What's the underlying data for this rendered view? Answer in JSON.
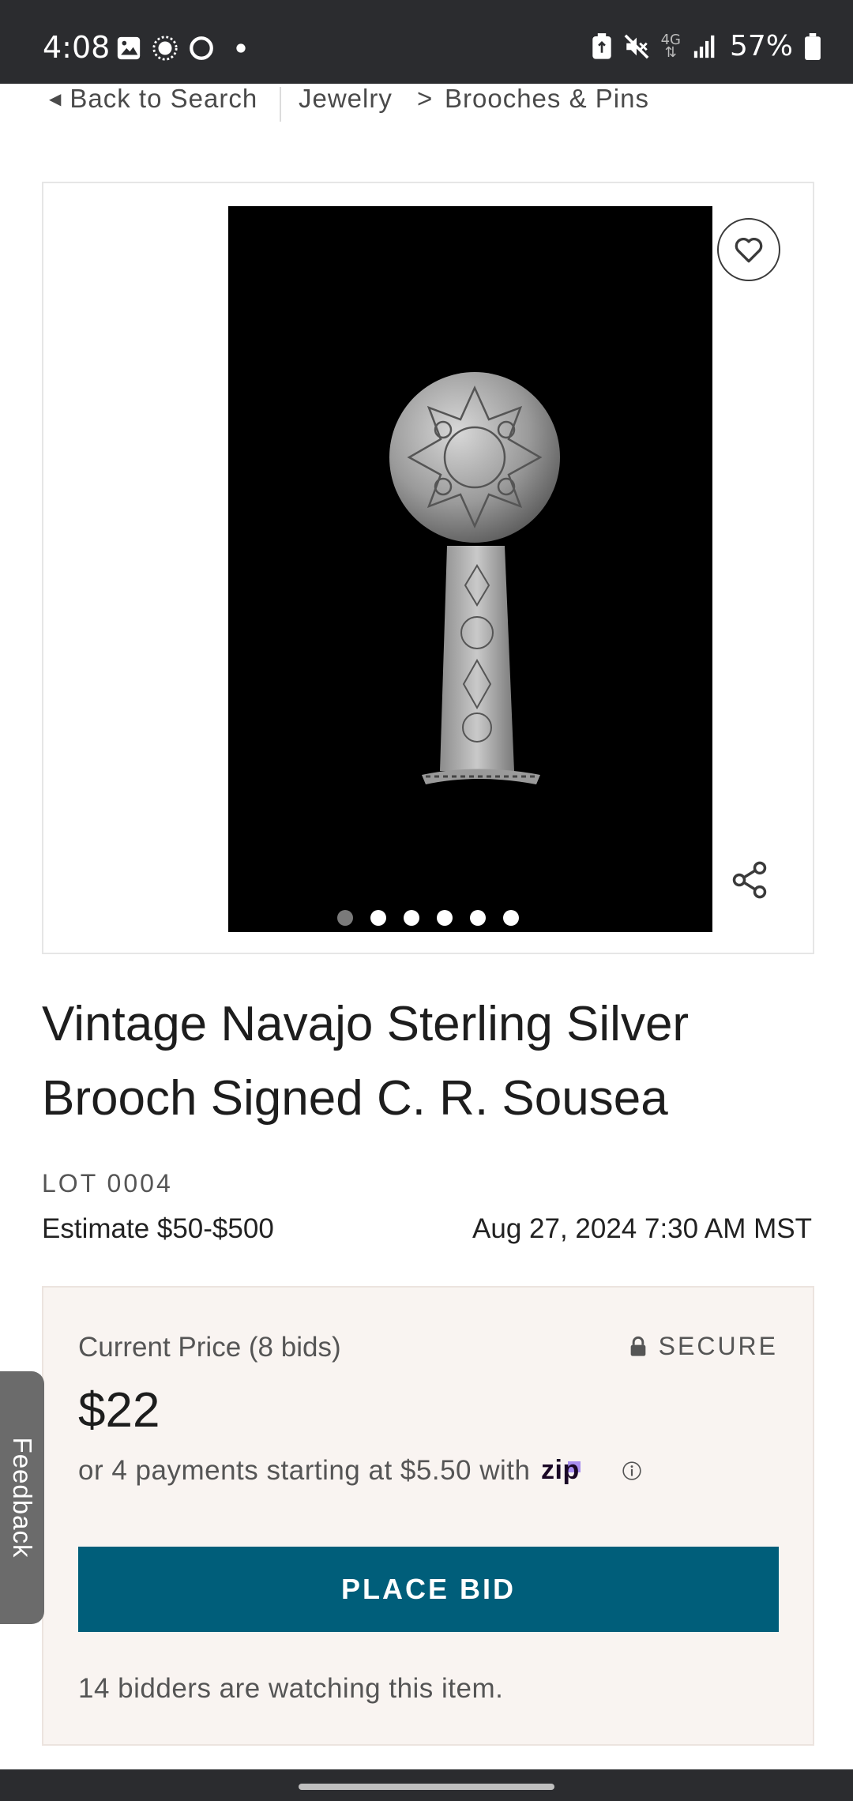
{
  "status_bar": {
    "time": "4:08",
    "battery": "57%",
    "network": "4G",
    "icons_left": [
      "gallery-icon",
      "record-icon",
      "circle-icon",
      "dot-icon"
    ],
    "icons_right": [
      "battery-saver-icon",
      "mute-icon",
      "4g-icon",
      "signal-icon",
      "battery-icon"
    ]
  },
  "breadcrumb": {
    "back_label": "Back to Search",
    "category": "Jewelry",
    "separator": ">",
    "subcategory": "Brooches & Pins"
  },
  "gallery": {
    "image_count": 6,
    "active_index": 0,
    "favorite_icon": "heart-icon",
    "share_icon": "share-icon"
  },
  "item": {
    "title": "Vintage Navajo Sterling Silver Brooch Signed C. R. Sousea",
    "lot": "LOT 0004",
    "estimate": "Estimate $50-$500",
    "date": "Aug 27, 2024 7:30 AM MST"
  },
  "bid_panel": {
    "current_price_label": "Current Price (8 bids)",
    "secure_label": "SECURE",
    "price": "$22",
    "payments_text": "or 4 payments starting at $5.50 with",
    "zip_logo_text": "zip",
    "place_bid_label": "PLACE BID",
    "watching_text": "14 bidders are watching this item."
  },
  "feedback_label": "Feedback",
  "colors": {
    "status_bar": "#2b2c2f",
    "accent_button": "#005e7a",
    "panel_bg": "#f9f4f1",
    "zip_purple": "#a98ff0"
  }
}
